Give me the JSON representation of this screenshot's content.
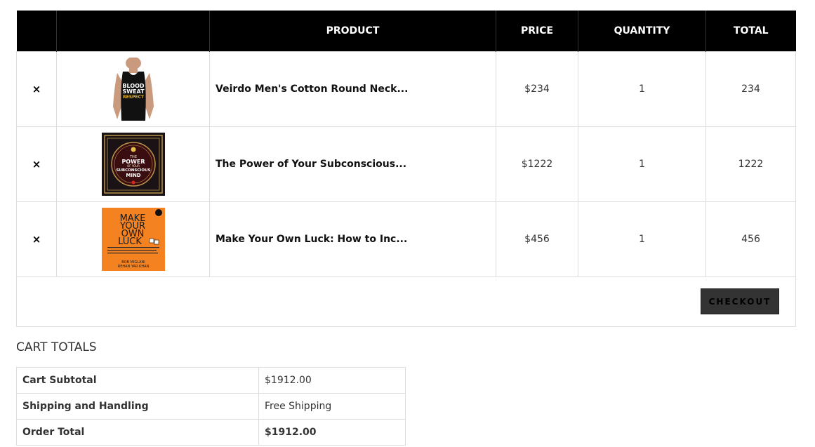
{
  "cart": {
    "headers": {
      "remove": "",
      "thumbnail": "",
      "product": "PRODUCT",
      "price": "PRICE",
      "quantity": "QUANTITY",
      "total": "TOTAL"
    },
    "remove_icon": "×",
    "items": [
      {
        "name": "Veirdo Men's Cotton Round Neck...",
        "price": "$234",
        "quantity": "1",
        "total": "234",
        "thumb": "tank-top-image",
        "thumb_text": [
          "BLOOD",
          "SWEAT",
          "RESPECT"
        ]
      },
      {
        "name": "The Power of Your Subconscious...",
        "price": "$1222",
        "quantity": "1",
        "total": "1222",
        "thumb": "book-cover-power-subconscious",
        "thumb_text": [
          "THE",
          "POWER",
          "OF YOUR",
          "SUBCONSCIOUS",
          "MIND"
        ]
      },
      {
        "name": "Make Your Own Luck: How to Inc...",
        "price": "$456",
        "quantity": "1",
        "total": "456",
        "thumb": "book-cover-make-your-own-luck",
        "thumb_text": [
          "MAKE",
          "YOUR",
          "OWN",
          "LUCK",
          "BOB MIGLANI",
          "REHAN YAR KHAN"
        ]
      }
    ],
    "checkout_label": "CHECKOUT"
  },
  "totals": {
    "title": "CART TOTALS",
    "rows": [
      {
        "label": "Cart Subtotal",
        "value": "$1912.00"
      },
      {
        "label": "Shipping and Handling",
        "value": "Free Shipping"
      },
      {
        "label": "Order Total",
        "value": "$1912.00"
      }
    ]
  },
  "colors": {
    "header_bg": "#000000",
    "book_orange": "#f58220",
    "book_dark": "#1a1214",
    "button_bg": "#333333"
  }
}
